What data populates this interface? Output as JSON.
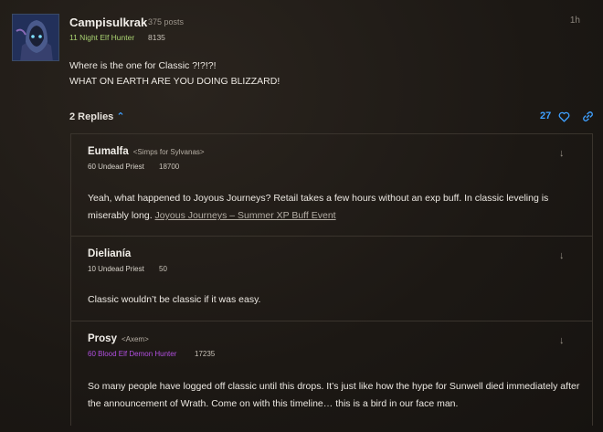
{
  "post": {
    "author": "Campisulkrak",
    "post_count": "375 posts",
    "character_class": "11 Night Elf Hunter",
    "achievement_points": "8135",
    "timestamp": "1h",
    "body_line1": "Where is the one for Classic ?!?!?!",
    "body_line2": "WHAT ON EARTH ARE YOU DOING BLIZZARD!",
    "replies_label": "2 Replies",
    "like_count": "27",
    "icons": {
      "replies_toggle": "chevron-up-icon",
      "like": "heart-icon",
      "share": "link-icon"
    },
    "colors": {
      "accent": "#3fa0ff",
      "hunter": "#a9d271",
      "demon_hunter": "#b14fe0"
    }
  },
  "replies": [
    {
      "author": "Eumalfa",
      "guild": "<Simps for Sylvanas>",
      "character_class": "60 Undead Priest",
      "achievement_points": "18700",
      "body": "Yeah, what happened to Joyous Journeys? Retail takes a few hours without an exp buff. In classic leveling is miserably long.",
      "link_text": "Joyous Journeys – Summer XP Buff Event"
    },
    {
      "author": "Dielianía",
      "guild": "",
      "character_class": "10 Undead Priest",
      "achievement_points": "50",
      "body": "Classic wouldn’t be classic if it was easy.",
      "link_text": ""
    },
    {
      "author": "Prosy",
      "guild": "<Axem>",
      "character_class": "60 Blood Elf Demon Hunter",
      "achievement_points": "17235",
      "body": "So many people have logged off classic until this drops. It’s just like how the hype for Sunwell died immediately after the announcement of Wrath. Come on with this timeline… this is a bird in our face man.",
      "link_text": ""
    }
  ]
}
